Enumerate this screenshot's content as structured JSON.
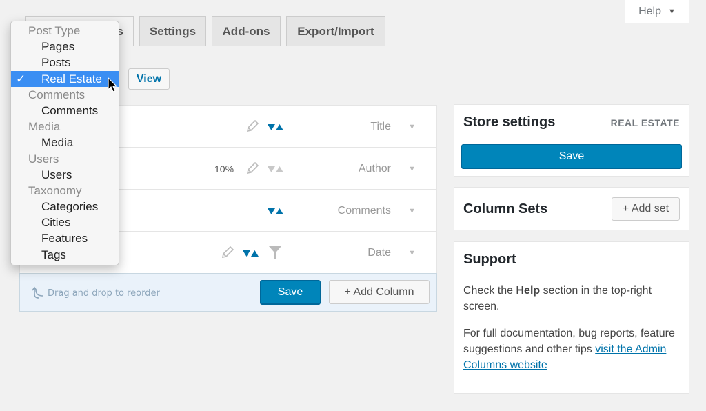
{
  "help": {
    "label": "Help",
    "caret": "▼"
  },
  "tabs": [
    {
      "label": "s",
      "active": true
    },
    {
      "label": "Settings"
    },
    {
      "label": "Add-ons"
    },
    {
      "label": "Export/Import"
    }
  ],
  "view_button": "View",
  "columns": [
    {
      "label": "Title",
      "sort_active": true
    },
    {
      "label": "Author",
      "width": "10%",
      "sort_active": false
    },
    {
      "label": "Comments",
      "sort_active": true
    },
    {
      "label": "Date",
      "sort_active": true,
      "filter": true
    }
  ],
  "footer": {
    "drag_hint": "Drag and drop to reorder",
    "save_label": "Save",
    "add_column_label": "+ Add Column"
  },
  "store_settings": {
    "title": "Store settings",
    "badge": "REAL ESTATE",
    "save_label": "Save"
  },
  "column_sets": {
    "title": "Column Sets",
    "add_label": "+ Add set"
  },
  "support": {
    "title": "Support",
    "line1_pre": "Check the ",
    "line1_bold": "Help",
    "line1_post": " section in the top-right screen.",
    "line2_pre": "For full documentation, bug reports, feature suggestions and other tips ",
    "line2_link": "visit the Admin Columns website"
  },
  "dropdown": {
    "check": "✓",
    "groups": [
      {
        "label": "Post Type",
        "options": [
          "Pages",
          "Posts",
          "Real Estate"
        ]
      },
      {
        "label": "Comments",
        "options": [
          "Comments"
        ]
      },
      {
        "label": "Media",
        "options": [
          "Media"
        ]
      },
      {
        "label": "Users",
        "options": [
          "Users"
        ]
      },
      {
        "label": "Taxonomy",
        "options": [
          "Categories",
          "Cities",
          "Features",
          "Tags"
        ]
      }
    ],
    "selected": "Real Estate"
  },
  "colors": {
    "primary": "#0085ba",
    "link": "#0073aa",
    "sort_active": "#0073aa",
    "sort_inactive": "#c8c8c8",
    "dropdown_selected": "#3a8ef3"
  }
}
